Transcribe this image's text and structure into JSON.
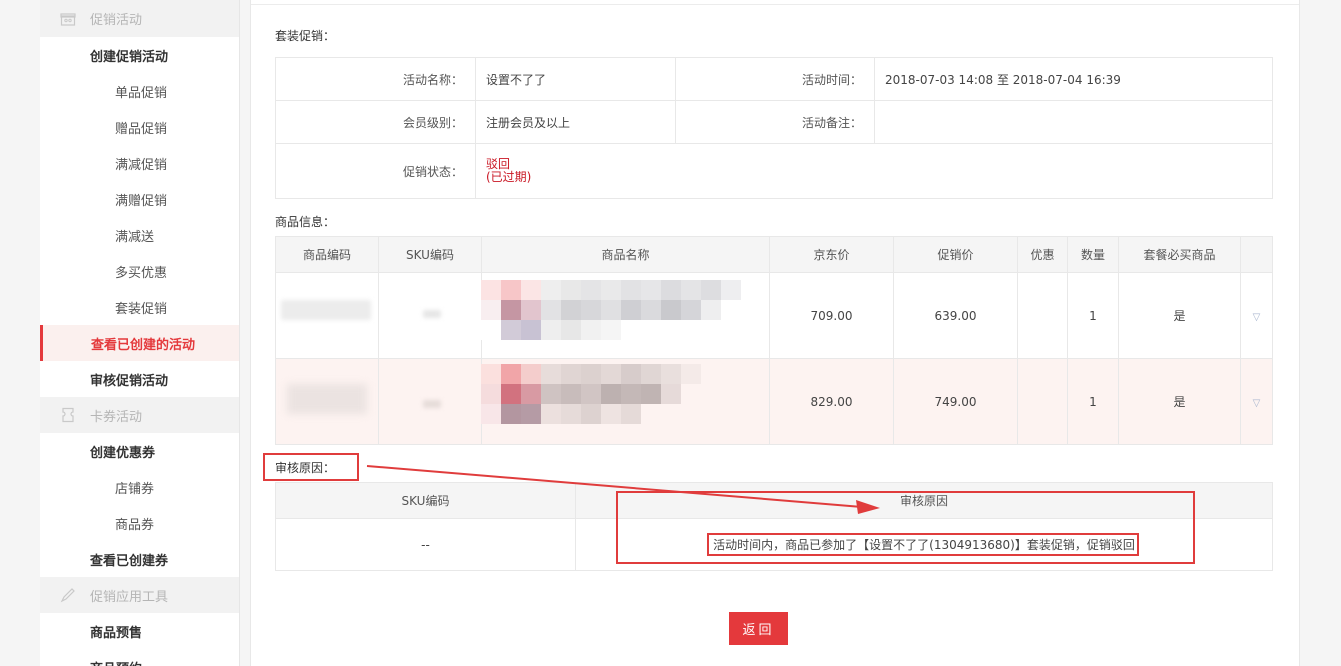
{
  "sidebar": {
    "sections": [
      {
        "label": "促销活动",
        "icon": "gift-box-icon"
      },
      {
        "label": "卡券活动",
        "icon": "coupon-icon"
      },
      {
        "label": "促销应用工具",
        "icon": "pen-tool-icon"
      }
    ],
    "promo": {
      "create_group": "创建促销活动",
      "items": [
        "单品促销",
        "赠品促销",
        "满减促销",
        "满赠促销",
        "满减送",
        "多买优惠",
        "套装促销"
      ],
      "view_created": "查看已创建的活动",
      "review": "审核促销活动"
    },
    "coupon": {
      "create_group": "创建优惠券",
      "items": [
        "店铺券",
        "商品券"
      ],
      "view_created": "查看已创建券"
    },
    "tools": {
      "items": [
        "商品预售",
        "商品预约"
      ]
    }
  },
  "main": {
    "package_label": "套装促销：",
    "info": {
      "name_key": "活动名称：",
      "name_val": "设置不了了",
      "time_key": "活动时间：",
      "time_val": "2018-07-03 14:08 至 2018-07-04 16:39",
      "level_key": "会员级别：",
      "level_val": "注册会员及以上",
      "remark_key": "活动备注：",
      "remark_val": "",
      "status_key": "促销状态：",
      "status_line1": "驳回",
      "status_line2": "(已过期)"
    },
    "goods_label": "商品信息：",
    "goods_headers": [
      "商品编码",
      "SKU编码",
      "商品名称",
      "京东价",
      "促销价",
      "优惠",
      "数量",
      "套餐必买商品"
    ],
    "goods_rows": [
      {
        "jd_price": "709.00",
        "promo_price": "639.00",
        "discount": "",
        "qty": "1",
        "must_buy": "是"
      },
      {
        "jd_price": "829.00",
        "promo_price": "749.00",
        "discount": "",
        "qty": "1",
        "must_buy": "是"
      }
    ],
    "reason_label": "审核原因：",
    "reason_headers": [
      "SKU编码",
      "审核原因"
    ],
    "reason_row": {
      "sku": "--",
      "reason": "活动时间内，商品已参加了【设置不了了(1304913680)】套装促销，促销驳回"
    },
    "back_button": "返回"
  },
  "colors": {
    "accent": "#e4393c",
    "annotation": "#e03c3c"
  }
}
